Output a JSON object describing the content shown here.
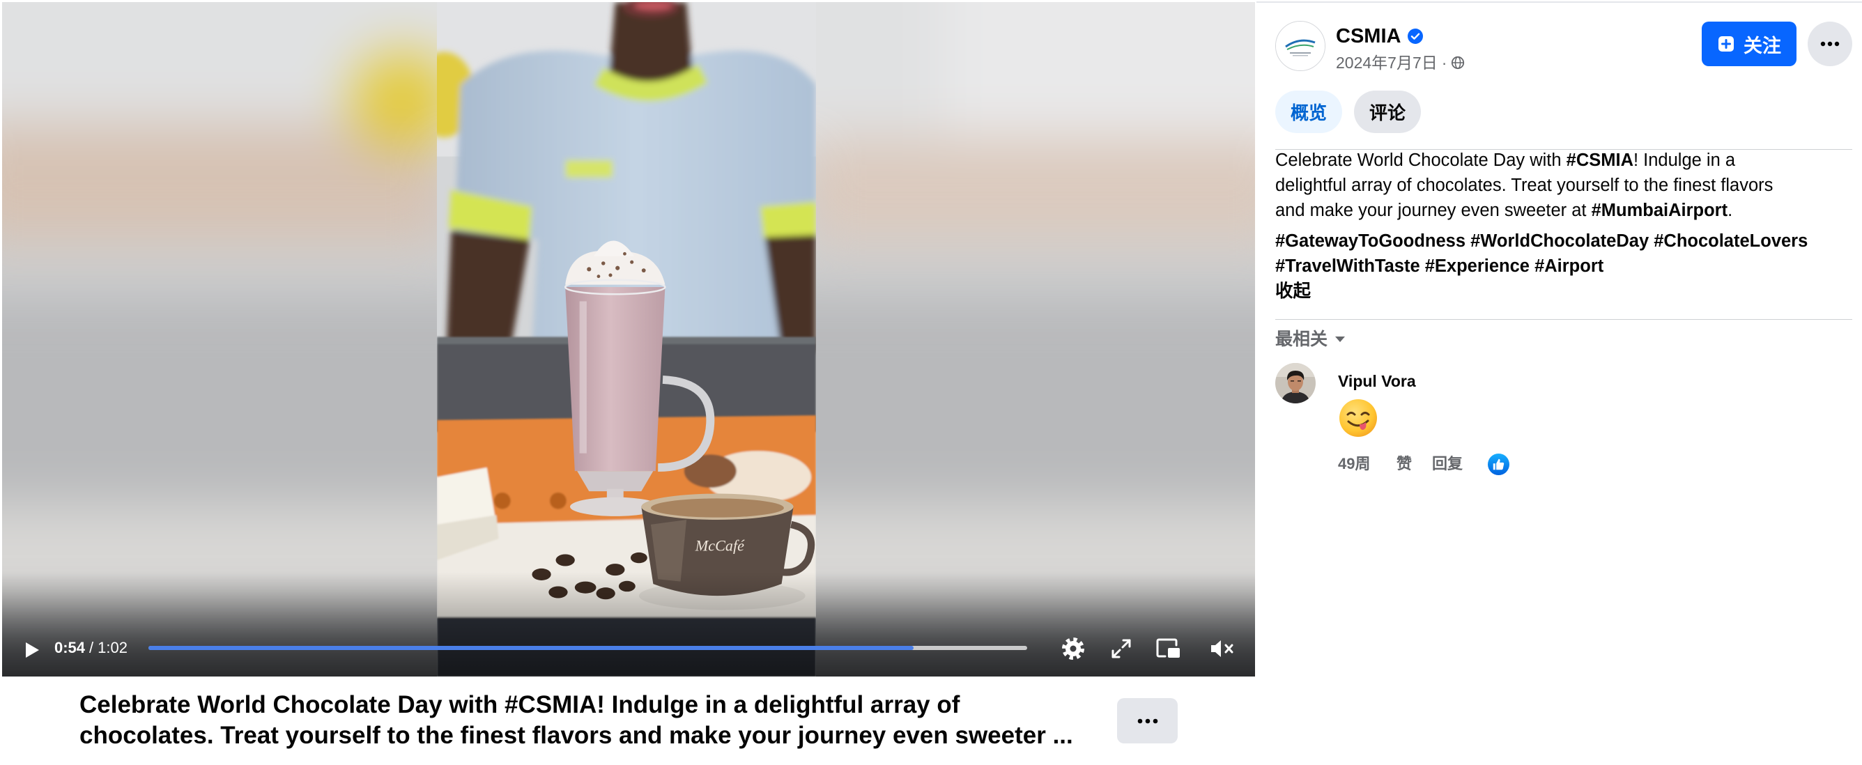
{
  "video": {
    "current_time": "0:54",
    "time_separator": "/",
    "duration": "1:02",
    "progress": 0.871,
    "progress_color": "#4a7fe8",
    "cup_logo_text": "McCafé",
    "controls": {
      "play_icon": "play-icon",
      "settings_icon": "settings-gear-icon",
      "fullscreen_icon": "fullscreen-icon",
      "pip_icon": "picture-in-picture-icon",
      "mute_icon": "volume-muted-icon"
    }
  },
  "caption": {
    "lines": [
      "Celebrate World Chocolate Day with #CSMIA! Indulge in a delightful array of",
      "chocolates. Treat yourself to the finest flavors and make your journey even sweeter ..."
    ],
    "more_icon": "more-horizontal-icon"
  },
  "post": {
    "page_name": "CSMIA",
    "avatar": "csmia-logo",
    "verified_icon": "verified-badge-icon",
    "date": "2024年7月7日",
    "date_separator": "·",
    "audience_icon": "globe-icon",
    "follow_button": {
      "label": "关注",
      "icon": "follow-icon",
      "color": "#0866ff"
    },
    "more_icon": "more-horizontal-icon"
  },
  "tabs": [
    {
      "label": "概览",
      "active": true
    },
    {
      "label": "评论",
      "active": false
    }
  ],
  "description": {
    "lines": [
      [
        {
          "text": "Celebrate World Chocolate Day with ",
          "bold": false
        },
        {
          "text": "#CSMIA",
          "bold": true
        },
        {
          "text": "! Indulge in a",
          "bold": false
        }
      ],
      [
        {
          "text": "delightful array of chocolates. Treat yourself to the finest flavors",
          "bold": false
        }
      ],
      [
        {
          "text": "and make your journey even sweeter at ",
          "bold": false
        },
        {
          "text": "#MumbaiAirport",
          "bold": true
        },
        {
          "text": ".",
          "bold": false
        }
      ]
    ],
    "hashtag_lines": [
      [
        "#GatewayToGoodness",
        "#WorldChocolateDay",
        "#ChocolateLovers"
      ],
      [
        "#TravelWithTaste",
        "#Experience",
        "#Airport"
      ]
    ],
    "collapse_label": "收起"
  },
  "comments_sort": {
    "label": "最相关",
    "icon": "caret-down-icon"
  },
  "comments": [
    {
      "author": "Vipul Vora",
      "content_emoji": "face-savoring-food-emoji",
      "age": "49周",
      "like_label": "赞",
      "reply_label": "回复",
      "reaction_icon": "like-icon"
    }
  ]
}
